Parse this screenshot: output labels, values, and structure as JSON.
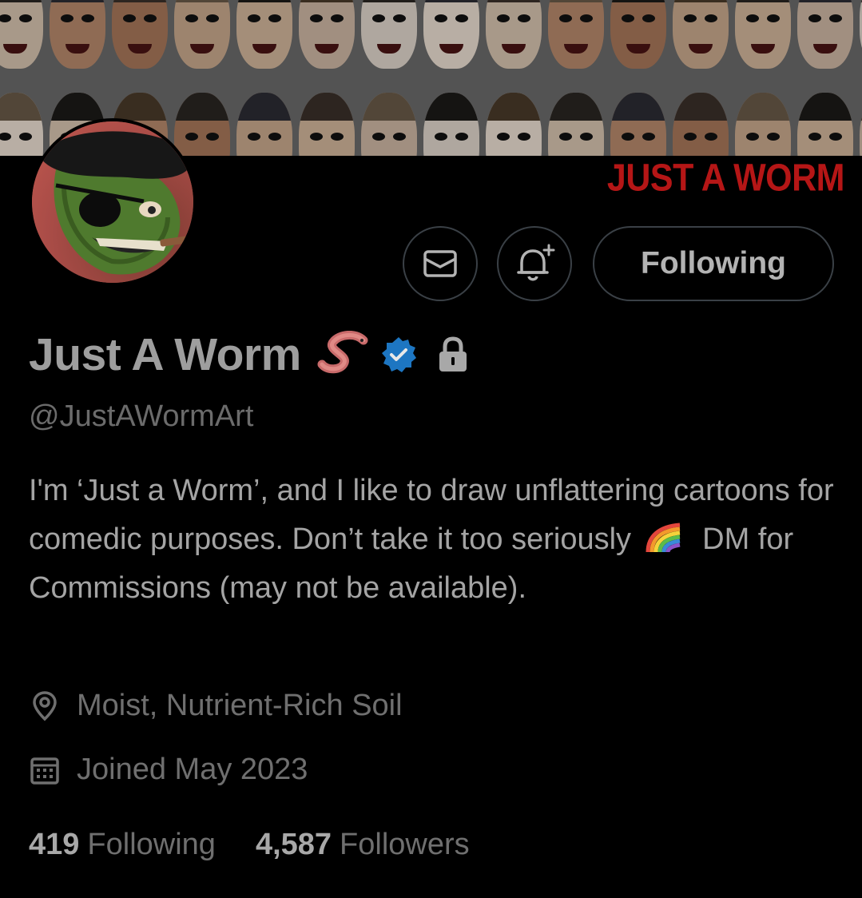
{
  "banner": {
    "title": "JUST A WORM",
    "title_color": "#b51616"
  },
  "profile": {
    "display_name": "Just A Worm",
    "handle": "@JustAWormArt",
    "verified_color": "#1d9bf0",
    "bio_part1": "I'm ‘Just a Worm’, and I like to draw unflattering cartoons for comedic purposes.  Don’t take it too seriously",
    "bio_part2": "DM for Commissions (may not be available).",
    "location": "Moist, Nutrient-Rich Soil",
    "joined": "Joined May 2023"
  },
  "actions": {
    "message_icon": "envelope-icon",
    "notify_icon": "bell-plus-icon",
    "following_label": "Following"
  },
  "stats": {
    "following_count": "419",
    "following_label": "Following",
    "followers_count": "4,587",
    "followers_label": "Followers"
  },
  "icons": {
    "name_emoji": "worm-emoji-icon",
    "verified": "verified-badge-icon",
    "protected": "lock-icon",
    "bio_emoji": "rainbow-emoji-icon",
    "location": "location-pin-icon",
    "joined": "calendar-icon"
  }
}
